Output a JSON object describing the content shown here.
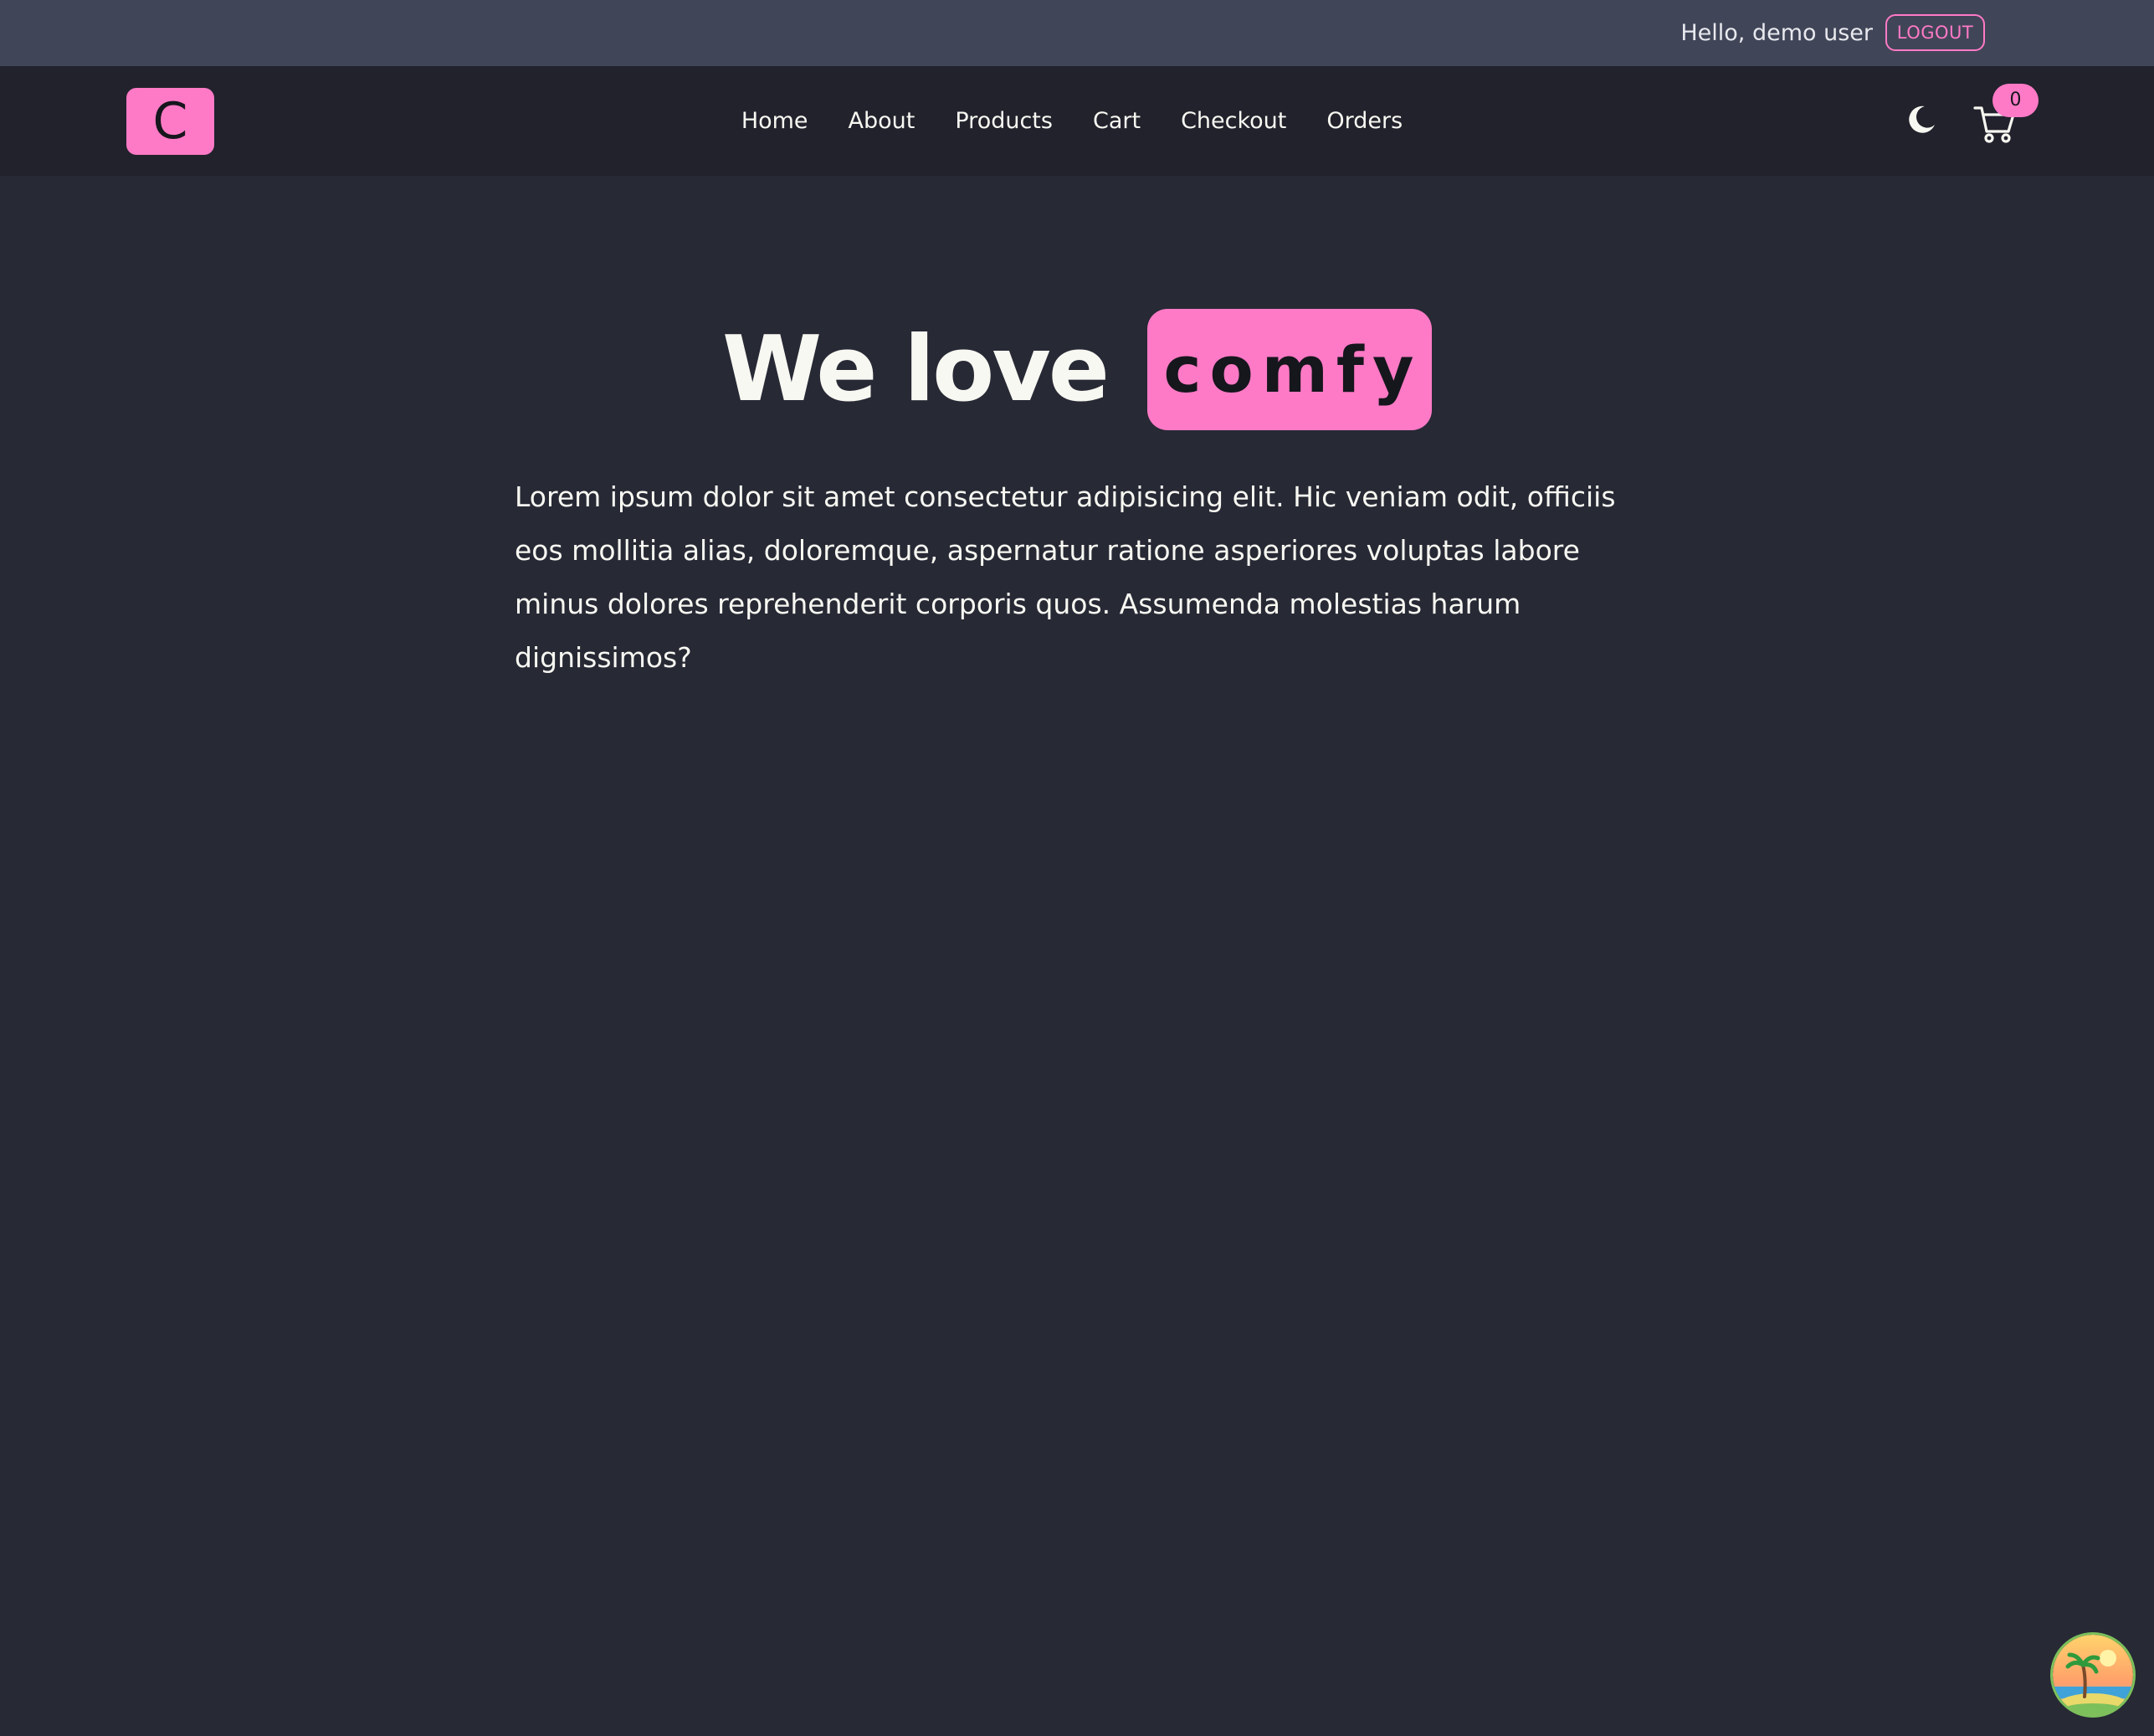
{
  "topbar": {
    "greeting": "Hello, demo user",
    "logout_label": "LOGOUT"
  },
  "navbar": {
    "logo_letter": "C",
    "links": [
      {
        "label": "Home"
      },
      {
        "label": "About"
      },
      {
        "label": "Products"
      },
      {
        "label": "Cart"
      },
      {
        "label": "Checkout"
      },
      {
        "label": "Orders"
      }
    ],
    "theme_icon": "moon-icon",
    "cart_icon": "cart-icon",
    "cart_count": "0"
  },
  "hero": {
    "title": "We love",
    "badge": "comfy",
    "paragraph": "Lorem ipsum dolor sit amet consectetur adipisicing elit. Hic veniam odit, officiis eos mollitia alias, doloremque, aspernatur ratione asperiores voluptas labore minus dolores reprehenderit corporis quos. Assumenda molestias harum dignissimos?"
  },
  "widget": {
    "icon": "beach-island-icon"
  },
  "colors": {
    "accent": "#ff7ac6",
    "background": "#272935",
    "navbar": "#21222c",
    "topbar": "#414558",
    "text": "#f8f8f2"
  }
}
